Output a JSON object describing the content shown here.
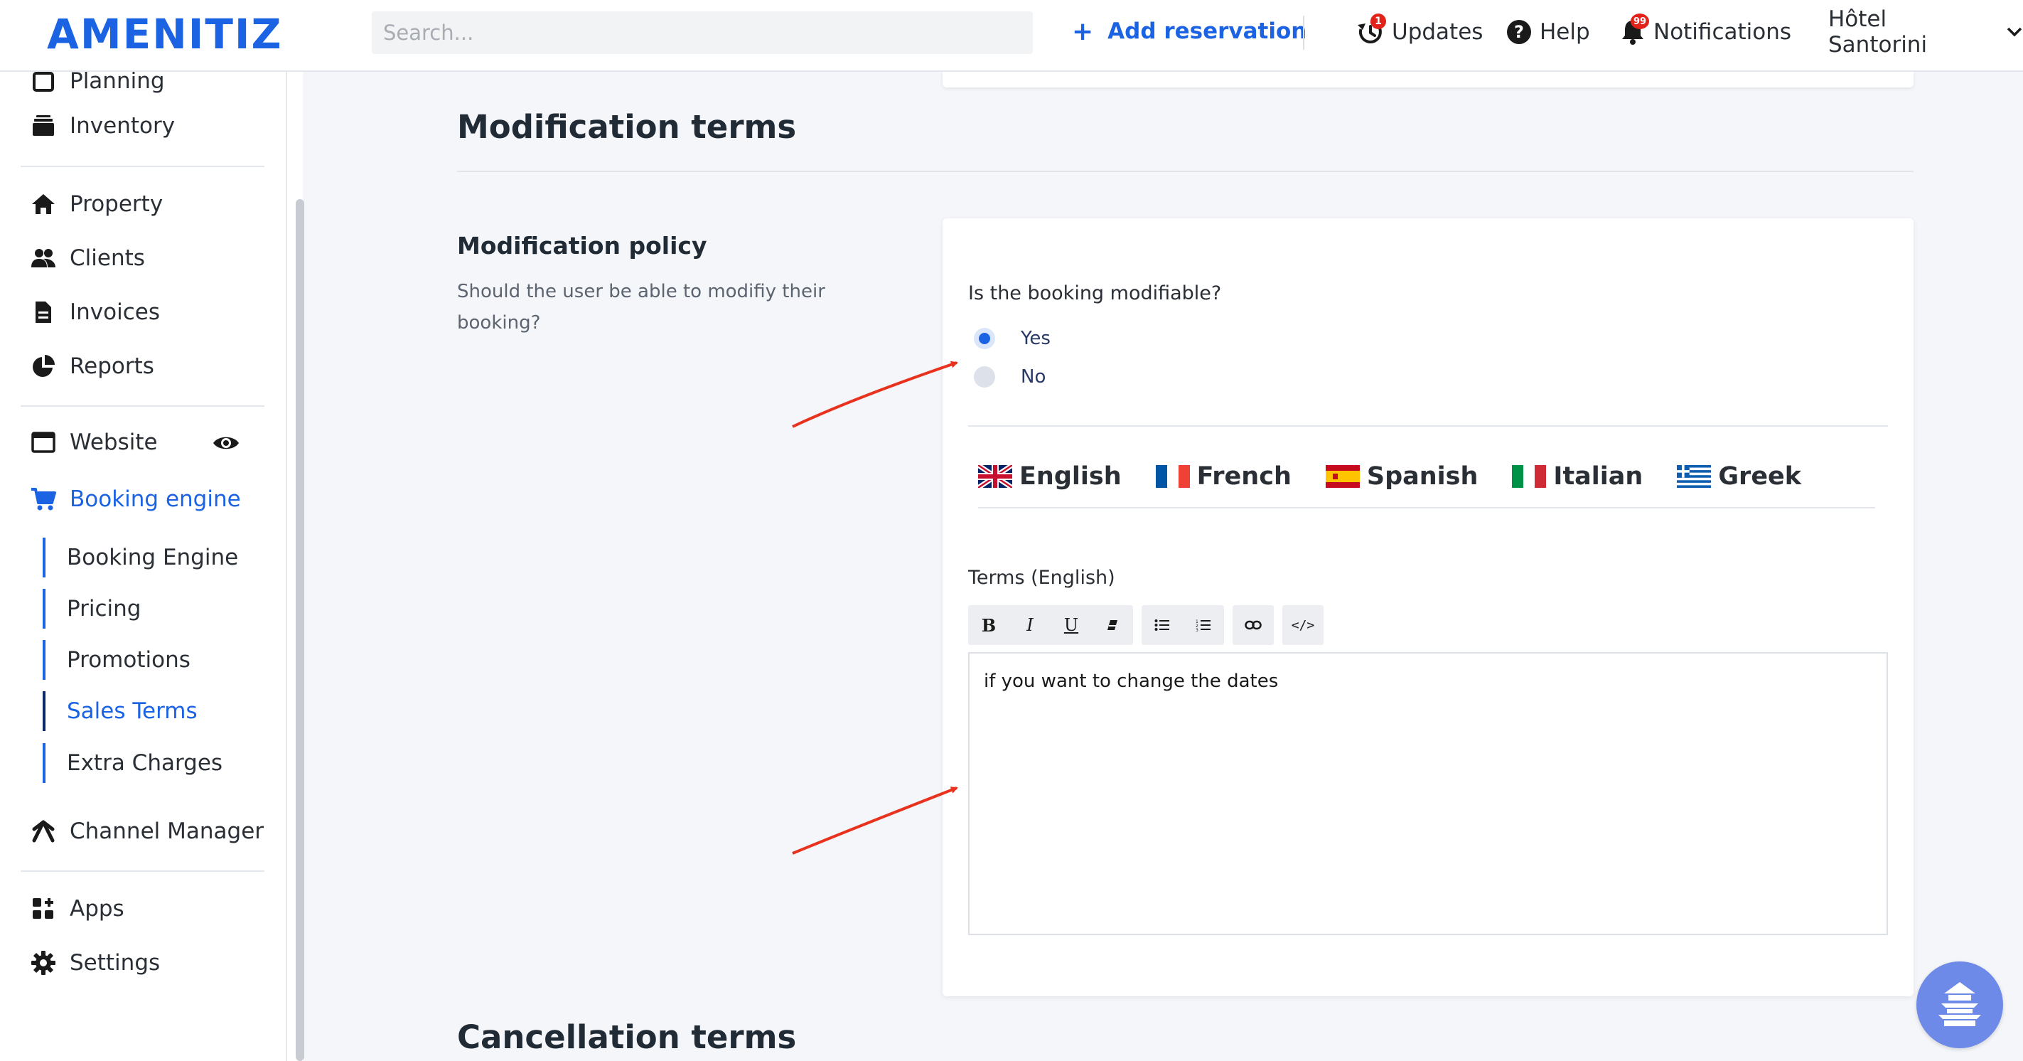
{
  "header": {
    "logo": "AMENITIZ",
    "search_placeholder": "Search...",
    "add_reservation": "Add reservation",
    "updates": "Updates",
    "updates_badge": "1",
    "help": "Help",
    "notifications": "Notifications",
    "notifications_badge": "99",
    "hotel_name": "Hôtel Santorini"
  },
  "sidebar": {
    "top_partial": "Planning",
    "inventory": "Inventory",
    "property": "Property",
    "clients": "Clients",
    "invoices": "Invoices",
    "reports": "Reports",
    "website": "Website",
    "booking_engine": "Booking engine",
    "sub": {
      "booking_engine": "Booking Engine",
      "pricing": "Pricing",
      "promotions": "Promotions",
      "sales_terms": "Sales Terms",
      "extra_charges": "Extra Charges"
    },
    "channel_manager": "Channel Manager",
    "apps": "Apps",
    "settings": "Settings"
  },
  "main": {
    "modification_title": "Modification terms",
    "policy_title": "Modification policy",
    "policy_desc": "Should the user be able to modifiy their booking?",
    "question": "Is the booking modifiable?",
    "options": {
      "yes": "Yes",
      "no": "No"
    },
    "selected": "yes",
    "languages": {
      "english": "English",
      "french": "French",
      "spanish": "Spanish",
      "italian": "Italian",
      "greek": "Greek"
    },
    "terms_label": "Terms (English)",
    "editor_text": "if you want to change the dates",
    "cancellation_title": "Cancellation terms"
  },
  "colors": {
    "accent": "#1c63e4",
    "annotation_arrow": "#e8321e"
  }
}
